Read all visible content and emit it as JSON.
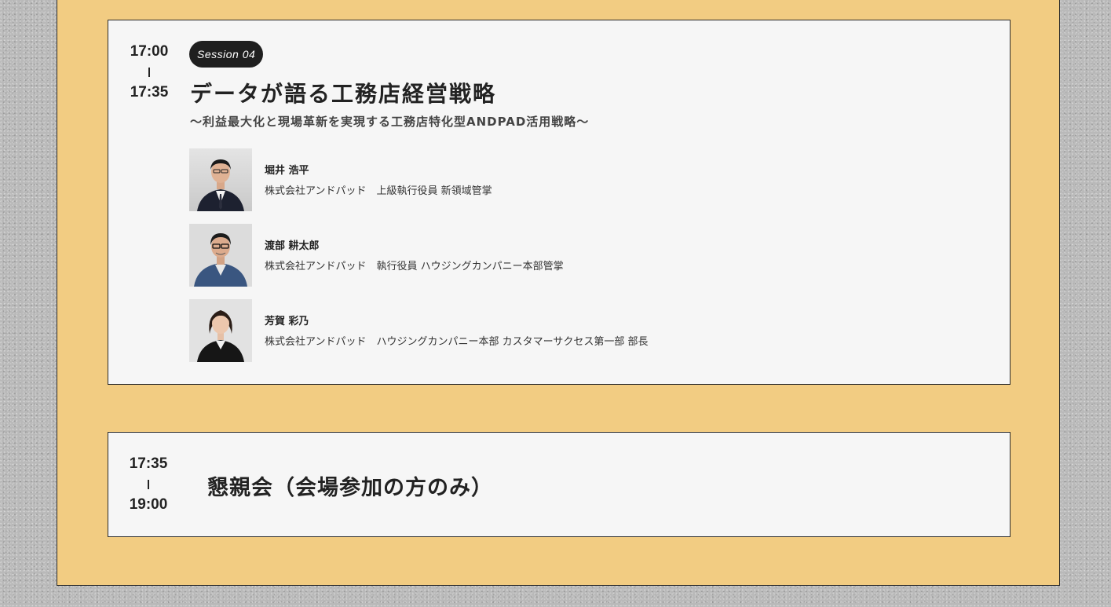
{
  "session": {
    "time_start": "17:00",
    "time_end": "17:35",
    "badge": "Session 04",
    "title": "データが語る工務店経営戦略",
    "subtitle": "〜利益最大化と現場革新を実現する工務店特化型ANDPAD活用戦略〜",
    "speakers": [
      {
        "name": "堀井 浩平",
        "role": "株式会社アンドパッド　上級執行役員 新領域管掌",
        "photo": "speaker-photo-man-suit"
      },
      {
        "name": "渡部 耕太郎",
        "role": "株式会社アンドパッド　執行役員 ハウジングカンパニー本部管掌",
        "photo": "speaker-photo-man-glasses"
      },
      {
        "name": "芳賀 彩乃",
        "role": "株式会社アンドパッド　ハウジングカンパニー本部 カスタマーサクセス第一部 部長",
        "photo": "speaker-photo-woman-suit"
      }
    ]
  },
  "party": {
    "time_start": "17:35",
    "time_end": "19:00",
    "title": "懇親会（会場参加の方のみ）"
  },
  "colors": {
    "panel": "#f2cc82",
    "card": "#f6f6f6",
    "badge": "#1f1f1f",
    "text": "#222222"
  }
}
